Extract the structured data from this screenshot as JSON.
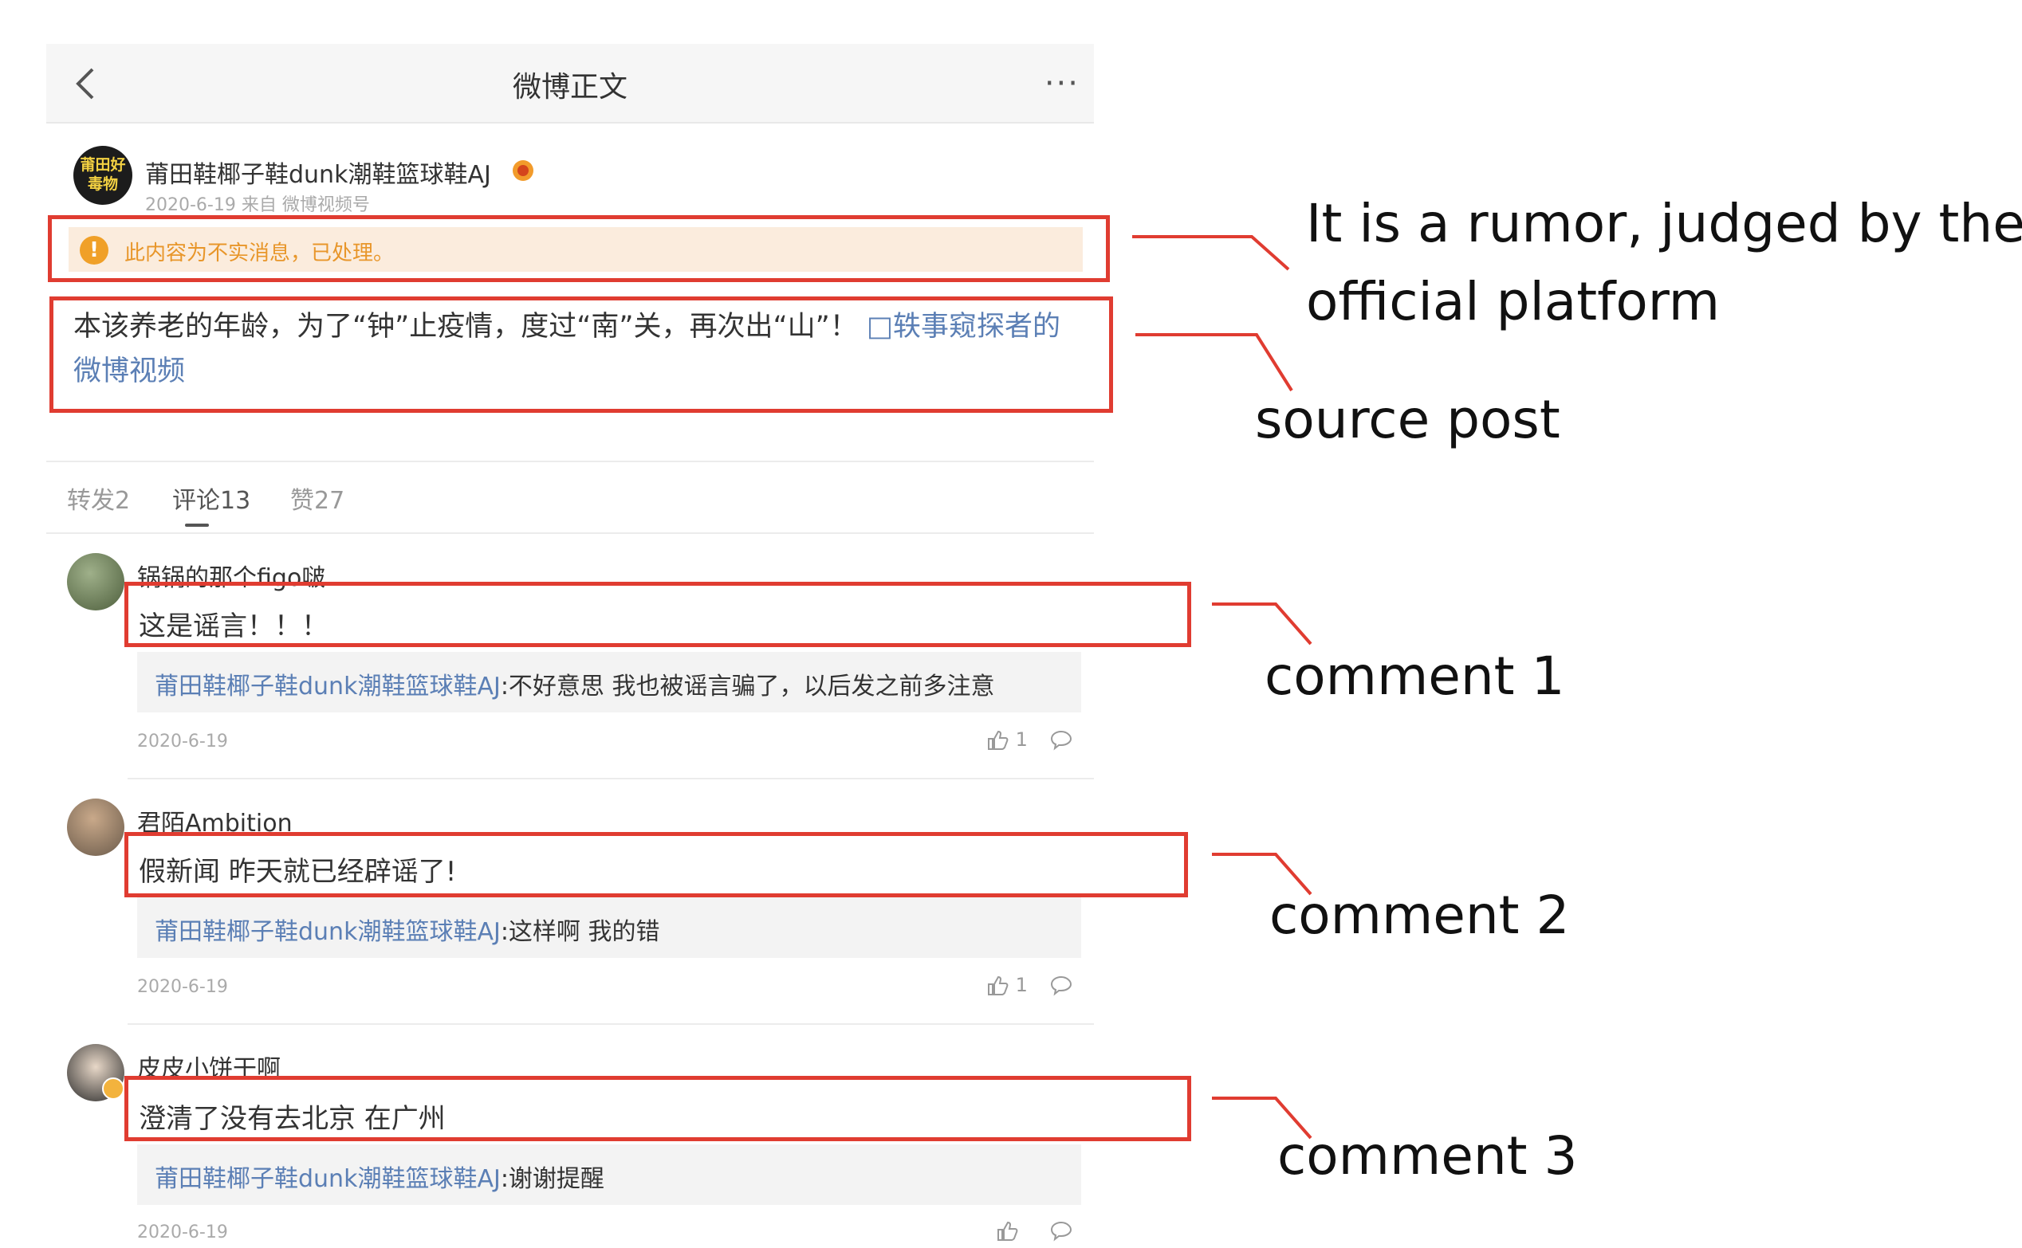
{
  "header": {
    "title": "微博正文"
  },
  "post": {
    "user_name": "莆田鞋椰子鞋dunk潮鞋篮球鞋AJ",
    "avatar_text": "莆田好毒物",
    "meta": "2020-6-19 来自 微博视频号",
    "warning": "此内容为不实消息，已处理。",
    "text": "本该养老的年龄，为了“钟”止疫情，度过“南”关，再次出“山”！",
    "video_link": "□轶事窥探者的微博视频"
  },
  "tabs": [
    {
      "label": "转发2"
    },
    {
      "label": "评论13"
    },
    {
      "label": "赞27"
    }
  ],
  "comments": [
    {
      "user": "锅锅的那个figo啵",
      "text": "这是谣言！！！",
      "reply_user": "莆田鞋椰子鞋dunk潮鞋篮球鞋AJ",
      "reply_text": ":不好意思 我也被谣言骗了，以后发之前多注意",
      "date": "2020-6-19",
      "likes": "1"
    },
    {
      "user": "君陌Ambition",
      "text": "假新闻 昨天就已经辟谣了!",
      "reply_user": "莆田鞋椰子鞋dunk潮鞋篮球鞋AJ",
      "reply_text": ":这样啊 我的错",
      "date": "2020-6-19",
      "likes": "1"
    },
    {
      "user": "皮皮小饼干啊",
      "text": "澄清了没有去北京 在广州",
      "reply_user": "莆田鞋椰子鞋dunk潮鞋篮球鞋AJ",
      "reply_text": ":谢谢提醒",
      "date": "2020-6-19",
      "likes": ""
    }
  ],
  "annotations": {
    "rumor_line1": "It  is  a  rumor,  judged  by  the",
    "rumor_line2": "official platform",
    "source_post": "source post",
    "comment1": "comment 1",
    "comment2": "comment 2",
    "comment3": "comment 3"
  },
  "colors": {
    "highlight_box": "#e03c31",
    "link": "#5b7fb5",
    "warning_bg": "#fbecdd",
    "warning_text": "#e8962a"
  }
}
